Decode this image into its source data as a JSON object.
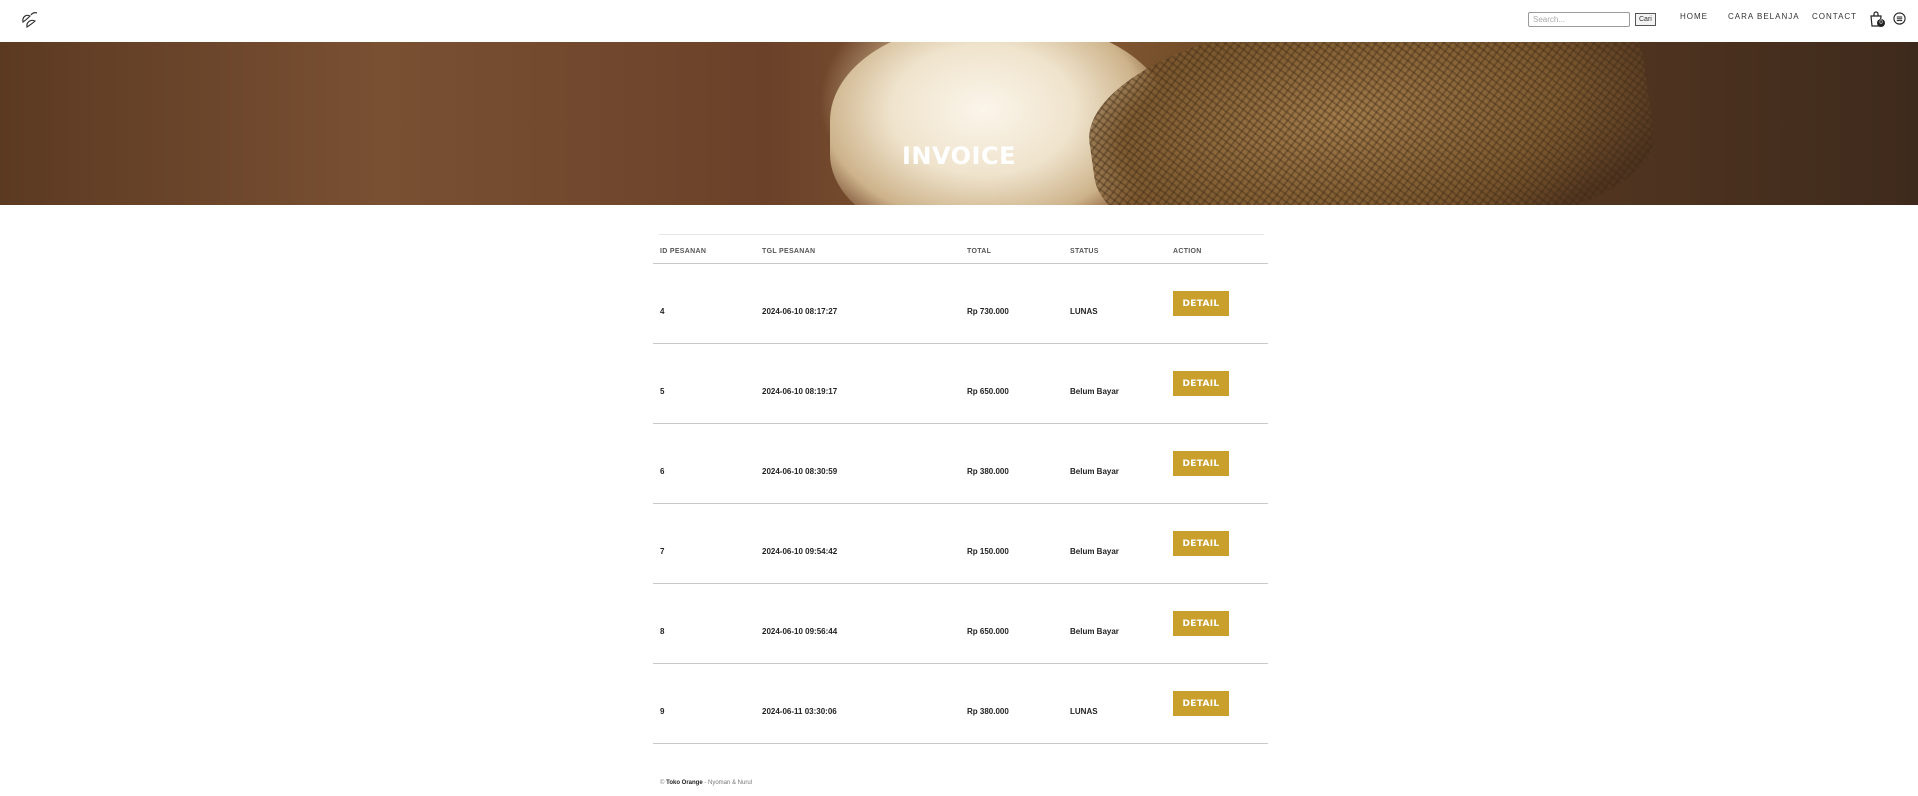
{
  "header": {
    "logo_icon": "leaf-logo-icon",
    "search_placeholder": "Search...",
    "search_button": "Cari",
    "nav": {
      "home": "HOME",
      "cara_belanja": "CARA BELANJA",
      "contact": "CONTACT"
    },
    "cart_icon": "shopping-bag-icon",
    "cart_count": "0",
    "menu_icon": "menu-circle-icon"
  },
  "hero": {
    "title": "INVOICE"
  },
  "table": {
    "headers": [
      "ID PESANAN",
      "TGL PESANAN",
      "TOTAL",
      "STATUS",
      "ACTION"
    ],
    "rows": [
      {
        "id": "4",
        "date": "2024-06-10 08:17:27",
        "total": "Rp 730.000",
        "status": "LUNAS",
        "action": "DETAIL"
      },
      {
        "id": "5",
        "date": "2024-06-10 08:19:17",
        "total": "Rp 650.000",
        "status": "Belum Bayar",
        "action": "DETAIL"
      },
      {
        "id": "6",
        "date": "2024-06-10 08:30:59",
        "total": "Rp 380.000",
        "status": "Belum Bayar",
        "action": "DETAIL"
      },
      {
        "id": "7",
        "date": "2024-06-10 09:54:42",
        "total": "Rp 150.000",
        "status": "Belum Bayar",
        "action": "DETAIL"
      },
      {
        "id": "8",
        "date": "2024-06-10 09:56:44",
        "total": "Rp 650.000",
        "status": "Belum Bayar",
        "action": "DETAIL"
      },
      {
        "id": "9",
        "date": "2024-06-11 03:30:06",
        "total": "Rp 380.000",
        "status": "LUNAS",
        "action": "DETAIL"
      }
    ]
  },
  "footer": {
    "copyright": "©",
    "brand": "Toko Orange",
    "credit": " - Nyoman & Nurul"
  },
  "colors": {
    "accent": "#c9a02c"
  }
}
